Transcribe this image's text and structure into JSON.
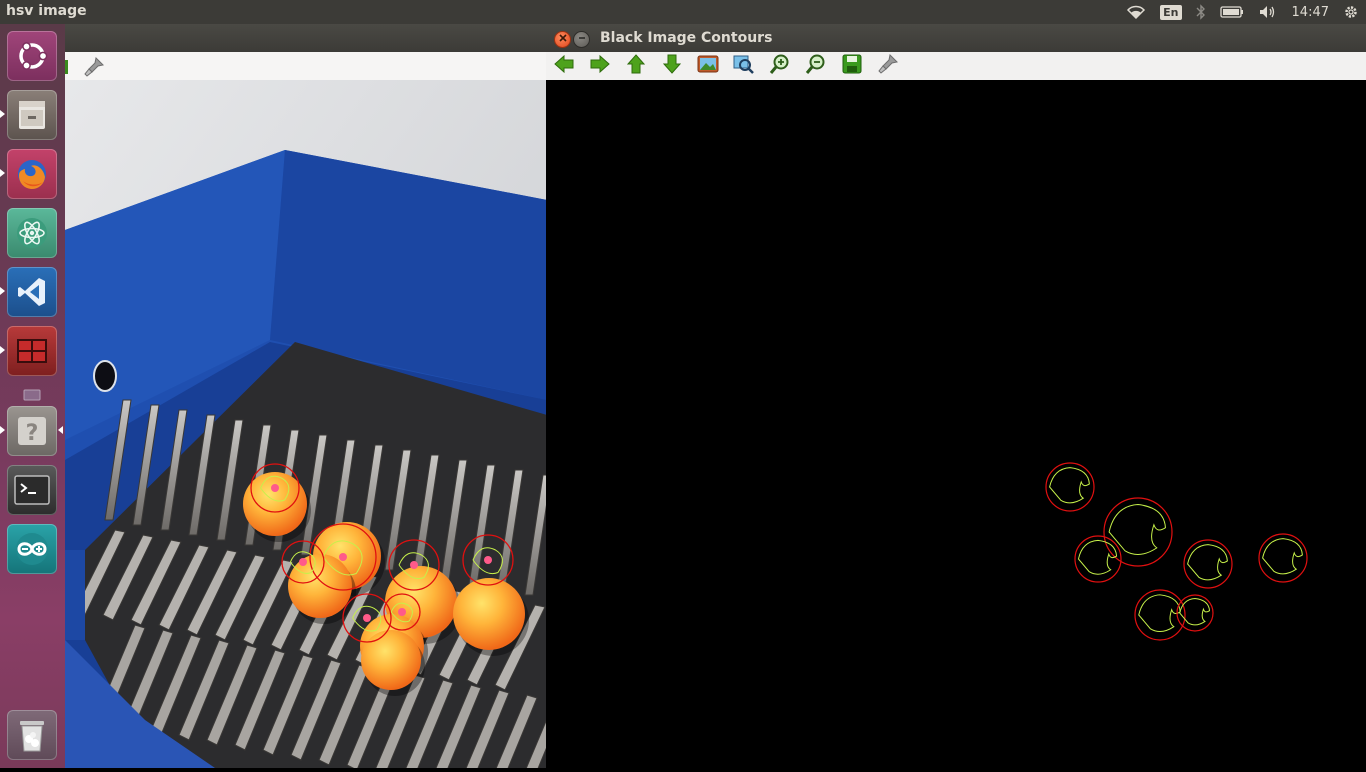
{
  "top_panel": {
    "window_title": "hsv image",
    "keyboard_layout": "En",
    "clock": "14:47"
  },
  "launcher": {
    "items": [
      {
        "name": "ubuntu-dash",
        "icon": "ubuntu-logo-icon"
      },
      {
        "name": "files",
        "icon": "file-cabinet-icon"
      },
      {
        "name": "firefox",
        "icon": "firefox-icon"
      },
      {
        "name": "atom",
        "icon": "atom-icon"
      },
      {
        "name": "vscode",
        "icon": "vscode-icon"
      },
      {
        "name": "workspace-switcher",
        "icon": "workspaces-icon"
      },
      {
        "name": "unknown-app",
        "icon": "question-mark-icon"
      },
      {
        "name": "terminal",
        "icon": "terminal-icon"
      },
      {
        "name": "arduino",
        "icon": "arduino-icon"
      },
      {
        "name": "trash",
        "icon": "trash-icon"
      }
    ]
  },
  "hsv_window": {
    "title": "hsv image"
  },
  "contours_window": {
    "title": "Black Image Contours",
    "toolbar": [
      {
        "name": "pan-left",
        "icon": "arrow-left-icon"
      },
      {
        "name": "pan-right",
        "icon": "arrow-right-icon"
      },
      {
        "name": "pan-up",
        "icon": "arrow-up-icon"
      },
      {
        "name": "pan-down",
        "icon": "arrow-down-icon"
      },
      {
        "name": "zoom-original",
        "icon": "image-icon"
      },
      {
        "name": "zoom-fit",
        "icon": "zoom-fit-icon"
      },
      {
        "name": "zoom-in",
        "icon": "zoom-in-icon"
      },
      {
        "name": "zoom-out",
        "icon": "zoom-out-icon"
      },
      {
        "name": "save",
        "icon": "save-icon"
      },
      {
        "name": "properties",
        "icon": "brush-icon"
      }
    ]
  },
  "colors": {
    "panel": "#3c3b37",
    "contour_green": "#c6f04a",
    "circle_red": "#e01010",
    "center_pink": "#ff5a8a",
    "close_button": "#f0572b"
  }
}
